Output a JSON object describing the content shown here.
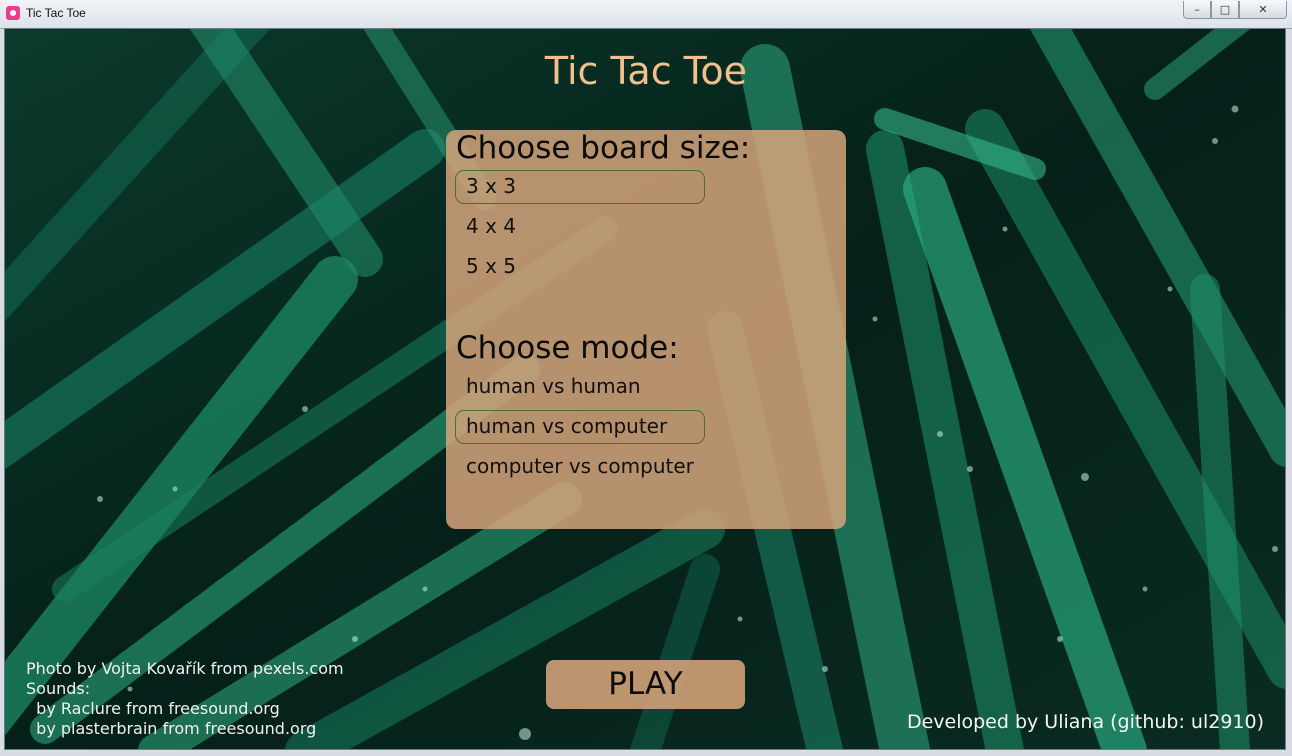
{
  "window": {
    "title": "Tic Tac Toe",
    "controls": {
      "minimize": "–",
      "maximize": "□",
      "close": "✕"
    }
  },
  "app": {
    "title": "Tic Tac Toe",
    "board_size": {
      "heading": "Choose board size:",
      "options": [
        "3 x 3",
        "4 x 4",
        "5 x 5"
      ],
      "selected": "3 x 3"
    },
    "mode": {
      "heading": "Choose mode:",
      "options": [
        "human vs human",
        "human vs computer",
        "computer vs computer"
      ],
      "selected": "human vs computer"
    },
    "play_label": "PLAY",
    "credits": {
      "photo": "Photo by Vojta Kovařík from pexels.com",
      "sounds_label": "Sounds:",
      "sound_1": "  by Raclure from freesound.org",
      "sound_2": "  by plasterbrain from freesound.org"
    },
    "developer": "Developed by Uliana (github: ul2910)"
  },
  "colors": {
    "title": "#f2c08b",
    "panel": "#d6a47d",
    "selected_border": "#4e6f2a",
    "background": "#06261d"
  }
}
